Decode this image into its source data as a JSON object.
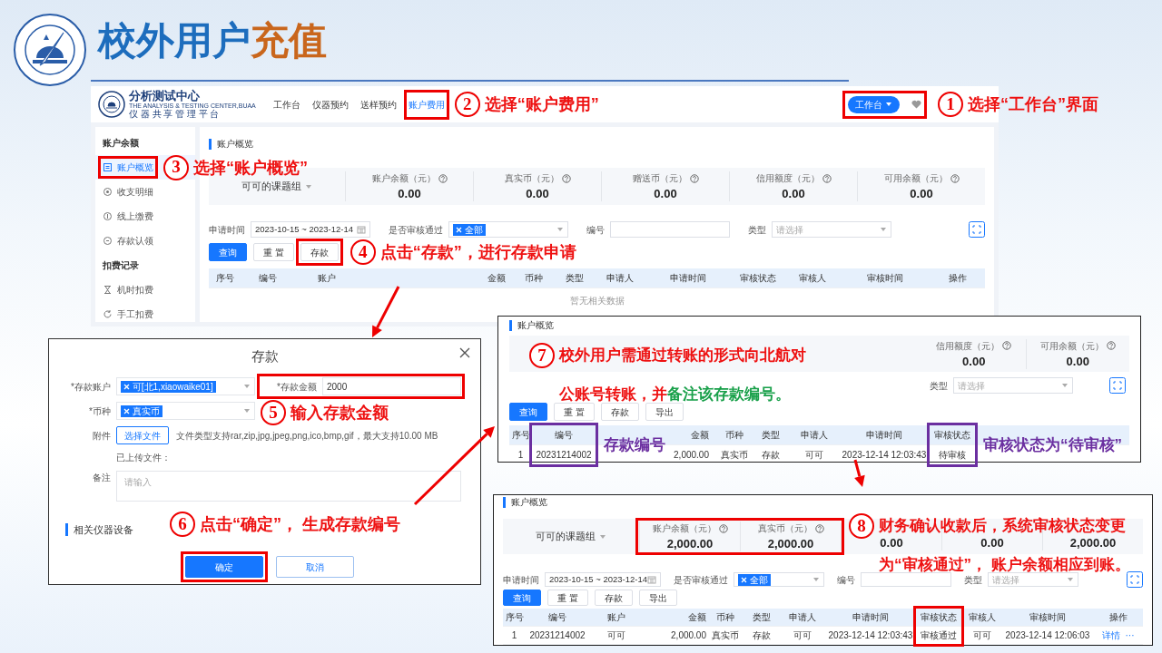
{
  "slide_title": {
    "primary": "校外用户",
    "accent": "充值"
  },
  "app": {
    "logo": {
      "name": "分析测试中心",
      "english": "THE ANALYSIS & TESTING CENTER,BUAA",
      "subtitle": "仪 器 共 享 管 理 平 台"
    },
    "nav": [
      {
        "label": "工作台",
        "selected": false
      },
      {
        "label": "仪器预约",
        "selected": false
      },
      {
        "label": "送样预约",
        "selected": false
      },
      {
        "label": "账户费用",
        "selected": true
      }
    ],
    "workbench_button": "工作台",
    "sidebar": [
      {
        "heading": "账户余额",
        "items": [
          {
            "label": "账户概览",
            "selected": true
          },
          {
            "label": "收支明细",
            "selected": false
          },
          {
            "label": "线上缴费",
            "selected": false
          },
          {
            "label": "存款认领",
            "selected": false
          }
        ]
      },
      {
        "heading": "扣费记录",
        "items": [
          {
            "label": "机时扣费",
            "selected": false
          },
          {
            "label": "手工扣费",
            "selected": false
          }
        ]
      }
    ],
    "overview": {
      "heading": "账户概览",
      "group": "可可的课题组",
      "stats": [
        {
          "label": "账户余额（元）",
          "value": "0.00"
        },
        {
          "label": "真实币（元）",
          "value": "0.00"
        },
        {
          "label": "赠送币（元）",
          "value": "0.00"
        },
        {
          "label": "信用额度（元）",
          "value": "0.00"
        },
        {
          "label": "可用余额（元）",
          "value": "0.00"
        }
      ],
      "filters": [
        {
          "kind": "date",
          "label": "申请时间",
          "value": "2023-10-15 ~ 2023-12-14"
        },
        {
          "kind": "tags",
          "label": "是否审核通过",
          "tag": "全部"
        },
        {
          "kind": "text",
          "label": "编号"
        },
        {
          "kind": "select",
          "label": "类型",
          "placeholder": "请选择"
        }
      ],
      "buttons": [
        {
          "label": "查询",
          "kind": "primary"
        },
        {
          "label": "重 置",
          "kind": "default"
        },
        {
          "label": "存款",
          "kind": "default"
        }
      ],
      "columns": [
        "序号",
        "编号",
        "账户",
        "金额",
        "币种",
        "类型",
        "申请人",
        "申请时间",
        "审核状态",
        "审核人",
        "审核时间",
        "操作"
      ],
      "empty": "暂无相关数据"
    }
  },
  "deposit_dialog": {
    "title": "存款",
    "fields": [
      {
        "kind": "select",
        "label": "*存款账户",
        "tag": "可[北1,xiaowaike01]"
      },
      {
        "kind": "input",
        "label": "*存款金额",
        "value": "2000"
      },
      {
        "kind": "select",
        "label": "*币种",
        "tag": "真实币"
      },
      {
        "kind": "file",
        "label": "附件",
        "button": "选择文件",
        "hint": "文件类型支持rar,zip,jpg,jpeg,png,ico,bmp,gif，最大支持10.00 MB"
      },
      {
        "kind": "note",
        "text": "已上传文件："
      },
      {
        "kind": "textarea",
        "label": "备注",
        "placeholder": "请输入"
      }
    ],
    "section": "相关仪器设备",
    "buttons": [
      {
        "label": "确定",
        "kind": "primary"
      },
      {
        "label": "取消",
        "kind": "outline"
      }
    ]
  },
  "screens": [
    {
      "heading": "账户概览",
      "stats": [
        {
          "label": "信用额度（元）",
          "value": "0.00"
        },
        {
          "label": "可用余额（元）",
          "value": "0.00"
        }
      ],
      "filters": [
        {
          "kind": "select",
          "label": "类型",
          "placeholder": "请选择"
        }
      ],
      "buttons": [
        {
          "label": "查询",
          "kind": "primary"
        },
        {
          "label": "重 置",
          "kind": "default"
        },
        {
          "label": "存款",
          "kind": "default"
        },
        {
          "label": "导出",
          "kind": "default"
        }
      ],
      "columns": [
        "序号",
        "编号",
        "金额",
        "币种",
        "类型",
        "申请人",
        "申请时间",
        "审核状态"
      ],
      "rows": [
        {
          "cells": [
            "1",
            "20231214002",
            "2,000.00",
            "真实币",
            "存款",
            "可可",
            "2023-12-14 12:03:43",
            "待审核"
          ]
        }
      ]
    },
    {
      "heading": "账户概览",
      "group": "可可的课题组",
      "stats": [
        {
          "label": "账户余额（元）",
          "value": "2,000.00"
        },
        {
          "label": "真实币（元）",
          "value": "2,000.00"
        },
        {
          "value": "0.00"
        },
        {
          "value": "0.00"
        },
        {
          "value": "2,000.00"
        }
      ],
      "filters": [
        {
          "kind": "date",
          "label": "申请时间",
          "value": "2023-10-15 ~ 2023-12-14"
        },
        {
          "kind": "tags",
          "label": "是否审核通过",
          "tag": "全部"
        },
        {
          "kind": "text",
          "label": "编号"
        },
        {
          "kind": "select",
          "label": "类型",
          "placeholder": "请选择"
        }
      ],
      "buttons": [
        {
          "label": "查询",
          "kind": "primary"
        },
        {
          "label": "重 置",
          "kind": "default"
        },
        {
          "label": "存款",
          "kind": "default"
        },
        {
          "label": "导出",
          "kind": "default"
        }
      ],
      "columns": [
        "序号",
        "编号",
        "账户",
        "金额",
        "币种",
        "类型",
        "申请人",
        "申请时间",
        "审核状态",
        "审核人",
        "审核时间",
        "操作"
      ],
      "rows": [
        {
          "cells": [
            "1",
            "20231214002",
            "可可",
            "2,000.00",
            "真实币",
            "存款",
            "可可",
            "2023-12-14 12:03:43",
            "审核通过",
            "可可",
            "2023-12-14 12:06:03"
          ],
          "actions": [
            "详情",
            "···"
          ]
        }
      ]
    }
  ],
  "annotations": [
    {
      "number": "2",
      "lines": [
        [
          {
            "text": "选择“账户费用”",
            "color": "#ee1111"
          }
        ]
      ]
    },
    {
      "number": "1",
      "lines": [
        [
          {
            "text": "选择“工作台”界面",
            "color": "#ee1111"
          }
        ]
      ]
    },
    {
      "number": "3",
      "lines": [
        [
          {
            "text": "选择“账户概览”",
            "color": "#ee1111"
          }
        ]
      ]
    },
    {
      "number": "4",
      "lines": [
        [
          {
            "text": "点击“存款”，进行存款申请",
            "color": "#ee1111"
          }
        ]
      ]
    },
    {
      "number": "5",
      "lines": [
        [
          {
            "text": "输入存款金额",
            "color": "#ee1111"
          }
        ]
      ]
    },
    {
      "number": "6",
      "lines": [
        [
          {
            "text": "点击“确定”， 生成存款编号",
            "color": "#ee1111"
          }
        ]
      ]
    },
    {
      "number": "7",
      "lines": [
        [
          {
            "text": "校外用户需通过转账的形式向北航对",
            "color": "#ee1111"
          }
        ],
        [
          {
            "text": "公账号转账，并",
            "color": "#ee1111"
          },
          {
            "text": "备注该存款编号。",
            "color": "#19a04a"
          }
        ]
      ]
    },
    {
      "number": "8",
      "lines": [
        [
          {
            "text": "财务确认收款后，系统审核状态变更",
            "color": "#ee1111"
          }
        ],
        [
          {
            "text": "为“审核通过”， 账户余额相应到账。",
            "color": "#ee1111"
          }
        ]
      ]
    }
  ],
  "callouts": [
    {
      "text": "存款编号"
    },
    {
      "text": "审核状态为“待审核”"
    }
  ]
}
